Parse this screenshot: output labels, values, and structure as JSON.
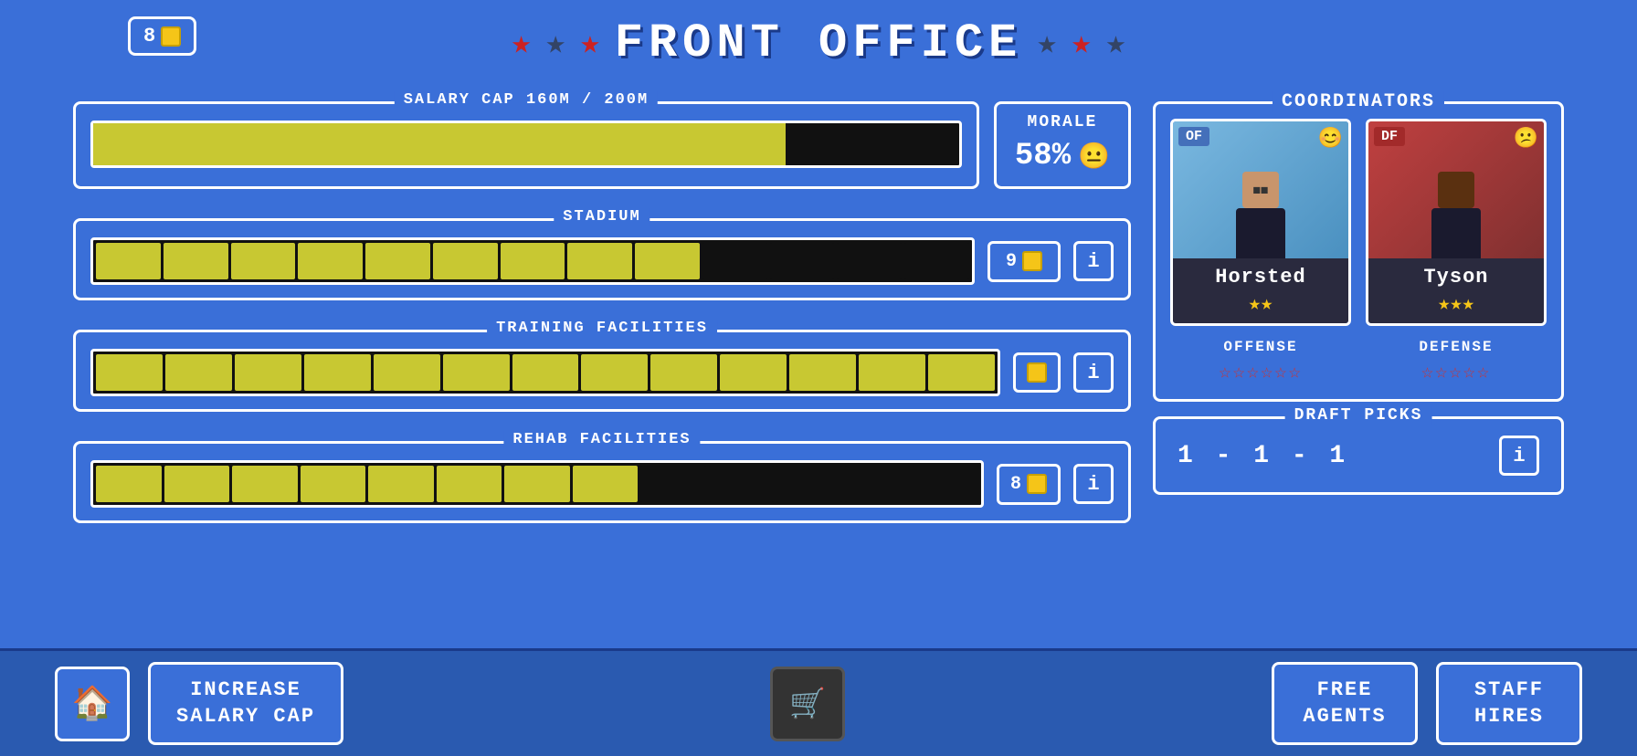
{
  "header": {
    "title": "FRONT OFFICE",
    "coins": "8",
    "stars_left": [
      "★",
      "★",
      "★"
    ],
    "stars_right": [
      "★",
      "★",
      "★"
    ]
  },
  "salary_cap": {
    "label": "SALARY CAP 160M / 200M",
    "current": 160,
    "max": 200,
    "fill_pct": 80
  },
  "morale": {
    "label": "MORALE",
    "value": "58%",
    "emoji": "😐"
  },
  "stadium": {
    "label": "STADIUM",
    "segments_filled": 9,
    "segments_total": 13,
    "cost": "9",
    "info_label": "i"
  },
  "training_facilities": {
    "label": "TRAINING FACILITIES",
    "segments_filled": 13,
    "segments_total": 13,
    "info_label": "i"
  },
  "rehab_facilities": {
    "label": "REHAB FACILITIES",
    "segments_filled": 8,
    "segments_total": 13,
    "cost": "8",
    "info_label": "i"
  },
  "coordinators": {
    "label": "COORDINATORS",
    "offense": {
      "name": "Horsted",
      "position": "OF",
      "stars": 2,
      "emoji": "😊",
      "role": "OFFENSE",
      "role_stars": 6
    },
    "defense": {
      "name": "Tyson",
      "position": "DF",
      "stars": 3,
      "emoji": "😕",
      "role": "DEFENSE",
      "role_stars": 5
    }
  },
  "draft_picks": {
    "label": "DRAFT PICKS",
    "value": "1 - 1 - 1",
    "info_label": "i"
  },
  "bottom_bar": {
    "home_label": "🏠",
    "increase_salary_cap": "INCREASE\nSALARY CAP",
    "free_agents": "FREE\nAGENTS",
    "staff_hires": "STAFF\nHIRES",
    "cart_icon": "🛒"
  }
}
